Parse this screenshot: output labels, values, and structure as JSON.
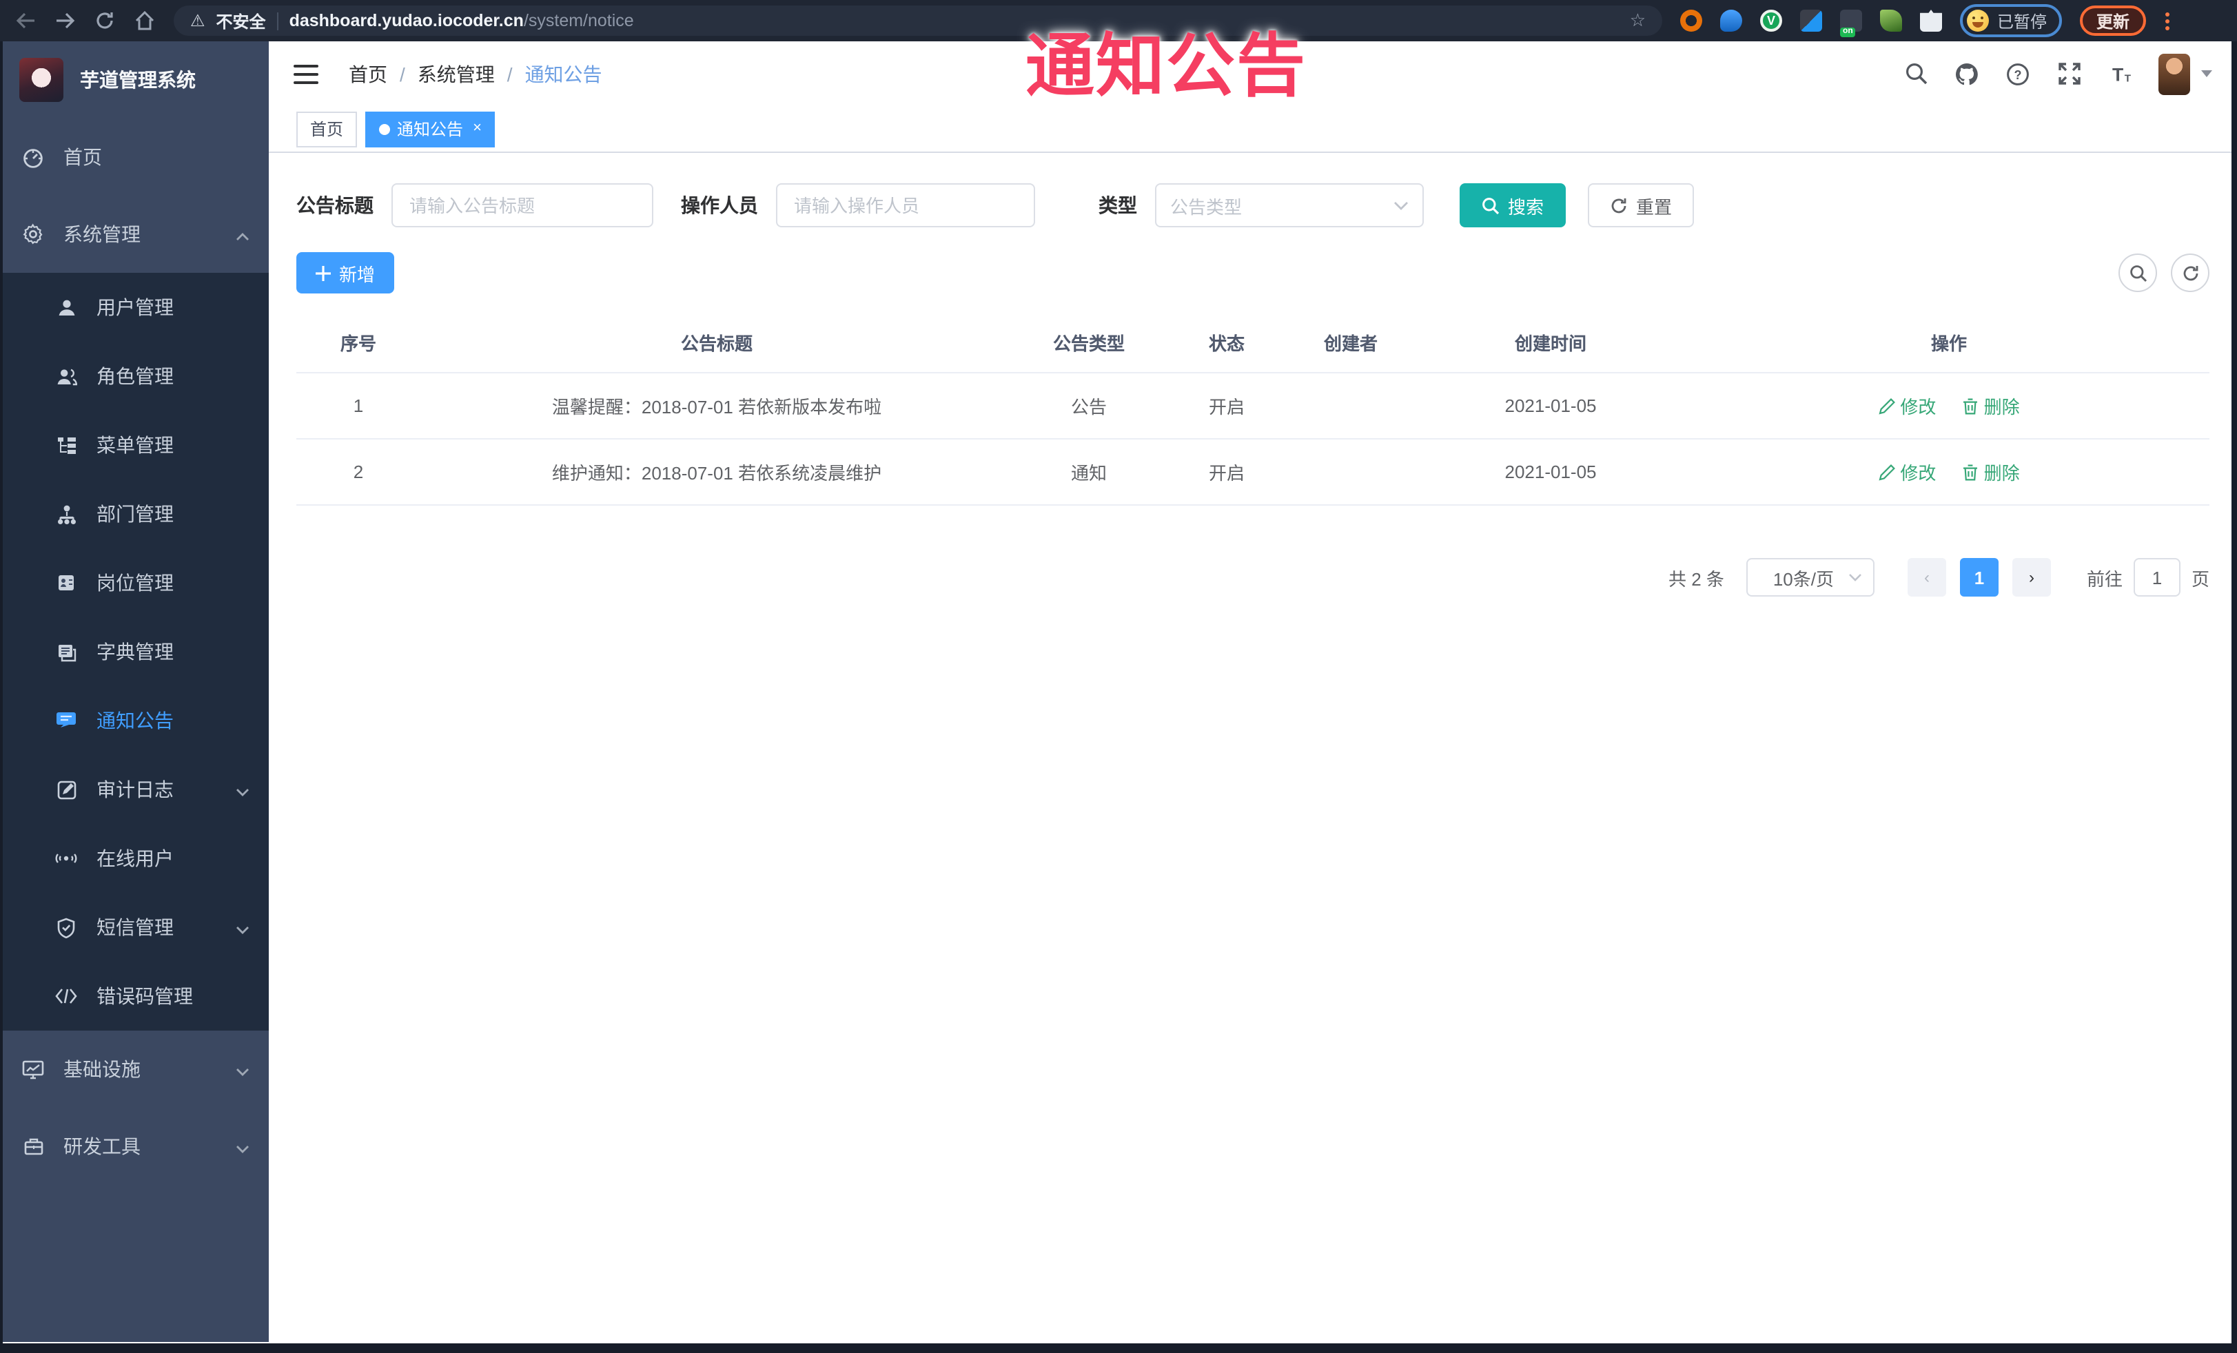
{
  "annotation": {
    "text": "通知公告",
    "color": "#f53e61"
  },
  "browser": {
    "security_label": "不安全",
    "url_host": "dashboard.yudao.iocoder.cn",
    "url_path": "/system/notice",
    "extension_badge": "on",
    "profile_label": "已暂停",
    "update_label": "更新"
  },
  "sidebar": {
    "app_title": "芋道管理系统",
    "home_label": "首页",
    "system_label": "系统管理",
    "submenu": [
      "用户管理",
      "角色管理",
      "菜单管理",
      "部门管理",
      "岗位管理",
      "字典管理",
      "通知公告",
      "审计日志",
      "在线用户",
      "短信管理",
      "错误码管理"
    ],
    "infra_label": "基础设施",
    "dev_label": "研发工具"
  },
  "header": {
    "breadcrumb": [
      "首页",
      "系统管理",
      "通知公告"
    ],
    "separator": "/"
  },
  "tabs": [
    {
      "label": "首页"
    },
    {
      "label": "通知公告",
      "close": "×"
    }
  ],
  "filters": {
    "title_label": "公告标题",
    "title_placeholder": "请输入公告标题",
    "operator_label": "操作人员",
    "operator_placeholder": "请输入操作人员",
    "type_label": "类型",
    "type_placeholder": "公告类型",
    "search_label": "搜索",
    "reset_label": "重置"
  },
  "toolbar": {
    "add_label": "新增"
  },
  "table": {
    "columns": [
      "序号",
      "公告标题",
      "公告类型",
      "状态",
      "创建者",
      "创建时间",
      "操作"
    ],
    "rows": [
      {
        "index": "1",
        "title": "温馨提醒：2018-07-01 若依新版本发布啦",
        "type": "公告",
        "status": "开启",
        "creator": "",
        "created": "2021-01-05",
        "edit": "修改",
        "delete": "删除"
      },
      {
        "index": "2",
        "title": "维护通知：2018-07-01 若依系统凌晨维护",
        "type": "通知",
        "status": "开启",
        "creator": "",
        "created": "2021-01-05",
        "edit": "修改",
        "delete": "删除"
      }
    ]
  },
  "pagination": {
    "total": "共 2 条",
    "page_size": "10条/页",
    "prev": "‹",
    "current": "1",
    "next": "›",
    "goto_label": "前往",
    "goto_value": "1",
    "page_unit": "页"
  },
  "colors": {
    "accent": "#409eff",
    "search_button": "#17b2aa",
    "action_link": "#36a777",
    "sidebar": "#3b4861",
    "submenu": "#202c3e"
  }
}
